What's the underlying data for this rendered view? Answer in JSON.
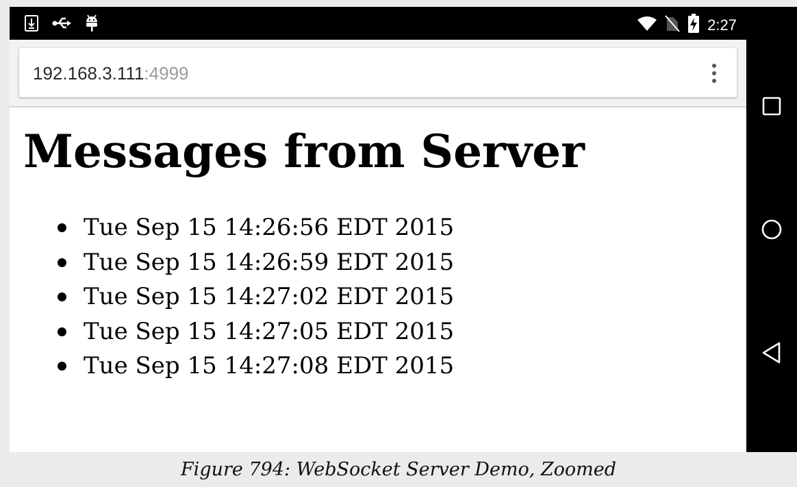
{
  "status_bar": {
    "time": "2:27",
    "left_icons": [
      "download-icon",
      "usb-icon",
      "android-debug-icon"
    ],
    "right_icons": [
      "wifi-icon",
      "no-sim-icon",
      "battery-charging-icon"
    ]
  },
  "browser": {
    "url_host": "192.168.3.111",
    "url_port": ":4999",
    "menu_icon": "overflow-menu-icon"
  },
  "page": {
    "title": "Messages from Server",
    "messages": [
      "Tue Sep 15 14:26:56 EDT 2015",
      "Tue Sep 15 14:26:59 EDT 2015",
      "Tue Sep 15 14:27:02 EDT 2015",
      "Tue Sep 15 14:27:05 EDT 2015",
      "Tue Sep 15 14:27:08 EDT 2015"
    ]
  },
  "navbar": {
    "buttons": [
      "recents-icon",
      "home-icon",
      "back-icon"
    ]
  },
  "caption": "Figure 794: WebSocket Server Demo, Zoomed",
  "colors": {
    "status_bar_bg": "#000000",
    "toolbar_bg": "#f2f2f2",
    "url_port": "#9a9a9a"
  }
}
